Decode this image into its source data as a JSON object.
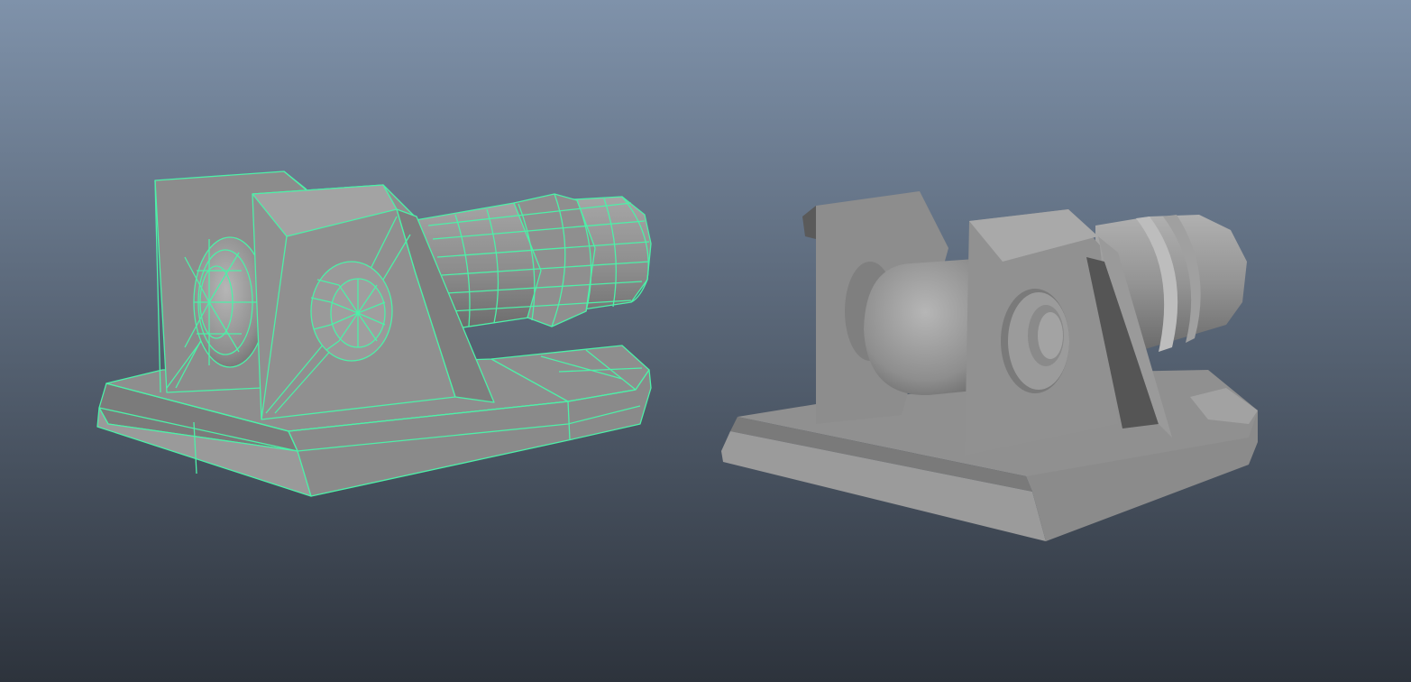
{
  "viewport": {
    "background_top": "#7f92aa",
    "background_bottom": "#2d333c"
  },
  "models": [
    {
      "name": "cannon-model",
      "display": "wireframe-on-shaded",
      "selected": true,
      "wire_color": "#4df0a8",
      "surface_light": "#a2a2a2",
      "surface_mid": "#8a8a8a",
      "surface_dark": "#5f5f5f"
    },
    {
      "name": "cannon-model",
      "display": "smooth-shaded",
      "selected": false,
      "surface_light": "#a8a8a8",
      "surface_mid": "#8c8c8c",
      "surface_dark": "#5c5c5c"
    }
  ]
}
